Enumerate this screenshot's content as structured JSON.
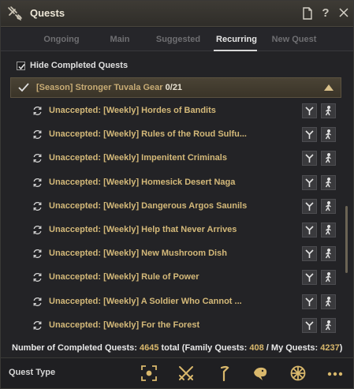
{
  "window": {
    "title": "Quests",
    "title_icon": "quest-scroll-icon",
    "buttons": [
      "document-icon",
      "help-icon",
      "close-icon"
    ]
  },
  "tabs": [
    {
      "label": "Ongoing",
      "active": false
    },
    {
      "label": "Main",
      "active": false
    },
    {
      "label": "Suggested",
      "active": false
    },
    {
      "label": "Recurring",
      "active": true
    },
    {
      "label": "New Quest",
      "active": false
    }
  ],
  "filter": {
    "hide_completed_label": "Hide Completed Quests",
    "hide_completed_checked": true
  },
  "group": {
    "name": "[Season] Stronger Tuvala Gear",
    "count": "0/21",
    "expanded": true
  },
  "quests": [
    {
      "label": "Unaccepted: [Weekly] Hordes of Bandits"
    },
    {
      "label": "Unaccepted: [Weekly] Rules of the Roud Sulfu..."
    },
    {
      "label": "Unaccepted: [Weekly] Impenitent Criminals"
    },
    {
      "label": "Unaccepted: [Weekly] Homesick Desert Naga"
    },
    {
      "label": "Unaccepted: [Weekly] Dangerous Argos Saunils"
    },
    {
      "label": "Unaccepted: [Weekly] Help that Never Arrives"
    },
    {
      "label": "Unaccepted: [Weekly] New Mushroom Dish"
    },
    {
      "label": "Unaccepted: [Weekly] Rule of Power"
    },
    {
      "label": "Unaccepted: [Weekly] A Soldier Who Cannot ..."
    },
    {
      "label": "Unaccepted: [Weekly] For the Forest"
    }
  ],
  "stats": {
    "prefix": "Number of Completed Quests:",
    "total": "4645",
    "total_suffix": "total (Family Quests:",
    "family": "408",
    "sep": "/ My Quests:",
    "mine": "4237",
    "close": ")"
  },
  "bottom": {
    "quest_type_label": "Quest Type",
    "icons": [
      "target-icon",
      "crossed-swords-icon",
      "sickle-icon",
      "dragon-icon",
      "wheel-icon",
      "more-icon"
    ]
  },
  "colors": {
    "quest_text": "#d4b979",
    "group_text": "#c8ac75",
    "stat_number": "#d9b86c"
  }
}
